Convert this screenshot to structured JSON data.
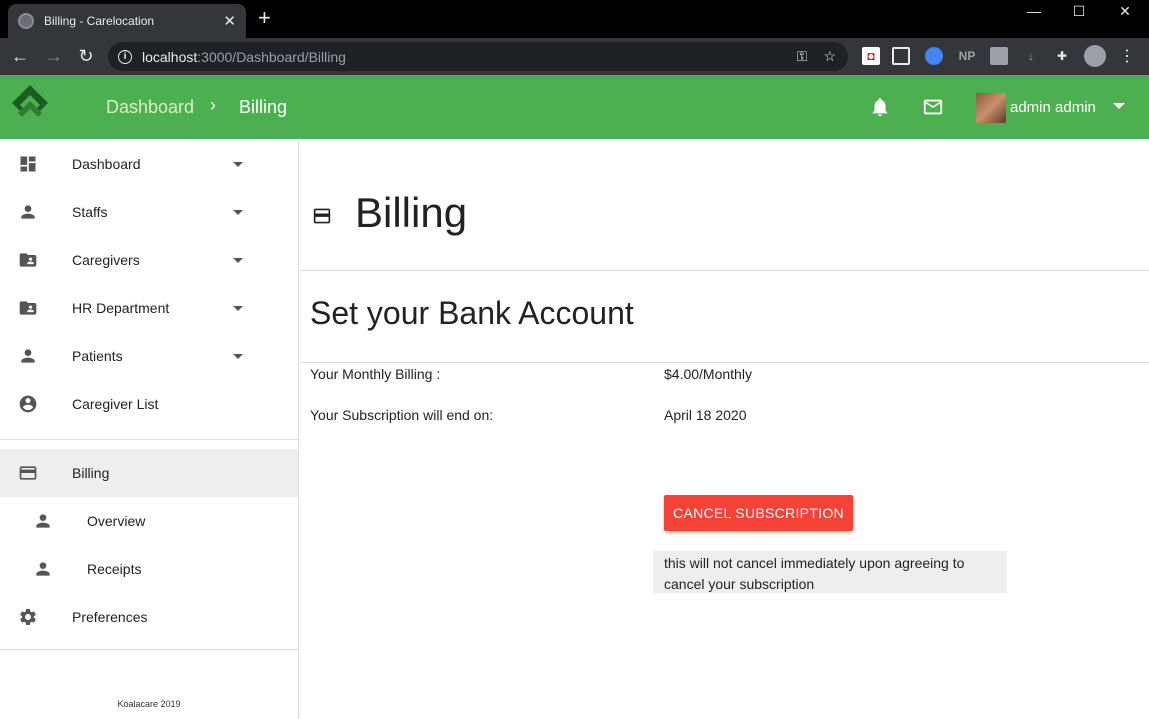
{
  "browser": {
    "tab_title": "Billing - Carelocation",
    "url_host": "localhost",
    "url_rest": ":3000/Dashboard/Billing",
    "extensions": [
      "NP"
    ]
  },
  "header": {
    "breadcrumb": [
      "Dashboard",
      "Billing"
    ],
    "user_name": "admin admin",
    "brand_color": "#4caf50"
  },
  "sidebar": {
    "items": [
      {
        "label": "Dashboard",
        "icon": "dashboard-icon",
        "caret": true
      },
      {
        "label": "Staffs",
        "icon": "person-icon",
        "caret": true
      },
      {
        "label": "Caregivers",
        "icon": "contact-folder-icon",
        "caret": true
      },
      {
        "label": "HR Department",
        "icon": "contact-folder-icon",
        "caret": true
      },
      {
        "label": "Patients",
        "icon": "person-icon",
        "caret": true
      },
      {
        "label": "Caregiver List",
        "icon": "account-circle-icon",
        "caret": false
      },
      {
        "label": "Billing",
        "icon": "credit-card-icon",
        "active": true
      },
      {
        "label": "Overview",
        "icon": "person-icon",
        "sub": true
      },
      {
        "label": "Receipts",
        "icon": "person-icon",
        "sub": true
      },
      {
        "label": "Preferences",
        "icon": "gear-icon"
      }
    ],
    "footer": "Koalacare 2019"
  },
  "main": {
    "title": "Billing",
    "section_title": "Set your Bank Account",
    "monthly_label": "Your Monthly Billing :",
    "monthly_value": "$4.00/Monthly",
    "end_label": "Your Subscription will end on:",
    "end_value": "April 18 2020",
    "cancel_button": "CANCEL SUBSCRIPTION",
    "note_line1": "this will not cancel immediately upon agreeing to",
    "note_line2": "cancel your subscription",
    "cancel_color": "#f44336"
  }
}
